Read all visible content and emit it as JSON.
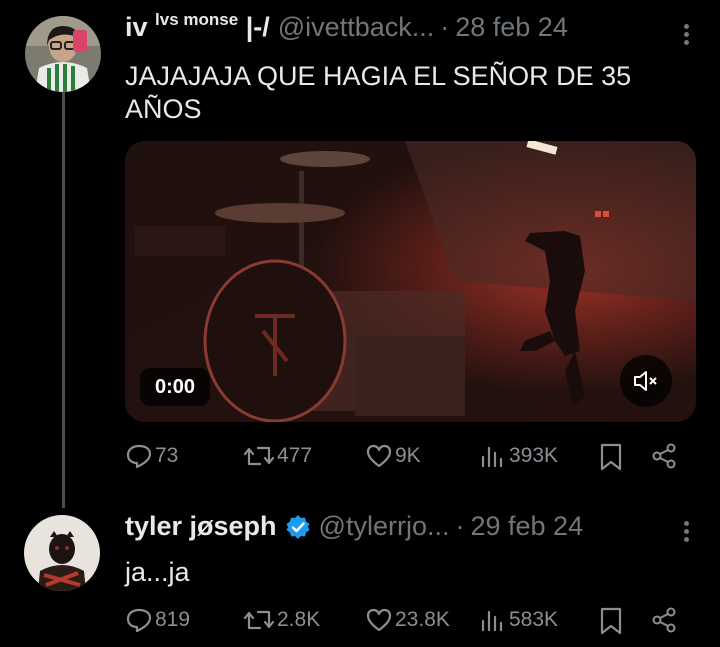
{
  "tweets": [
    {
      "name": "iv",
      "name_suffix": "lvs monse",
      "name_tail": "|-/",
      "handle": "@ivettback...",
      "date": "28 feb 24",
      "text": "JAJAJAJA QUE HAGIA EL SEÑOR DE 35\nAÑOS",
      "video_time": "0:00",
      "stats": {
        "replies": "73",
        "reposts": "477",
        "likes": "9K",
        "views": "393K"
      }
    },
    {
      "name": "tyler jøseph",
      "handle": "@tylerrjo...",
      "date": "29 feb 24",
      "verified": true,
      "text": "ja...ja",
      "stats": {
        "replies": "819",
        "reposts": "2.8K",
        "likes": "23.8K",
        "views": "583K"
      }
    }
  ],
  "colors": {
    "background": "#000000",
    "text": "#e7e9ea",
    "muted": "#71767b",
    "verified": "#1d9bf0"
  }
}
